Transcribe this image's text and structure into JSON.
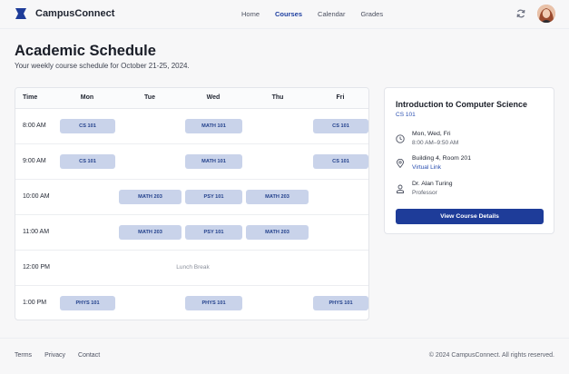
{
  "app": {
    "name": "CampusConnect",
    "nav": [
      {
        "label": "Home",
        "active": false
      },
      {
        "label": "Courses",
        "active": true
      },
      {
        "label": "Calendar",
        "active": false
      },
      {
        "label": "Grades",
        "active": false
      }
    ],
    "accent_color": "#1e3c99"
  },
  "page": {
    "title": "Academic Schedule",
    "subtitle": "Your weekly course schedule for October 21-25, 2024."
  },
  "schedule": {
    "headers": [
      "Time",
      "Mon",
      "Tue",
      "Wed",
      "Thu",
      "Fri"
    ],
    "rows": [
      {
        "time": "8:00 AM",
        "cells": [
          "CS 101",
          "",
          "MATH 101",
          "",
          "CS 101"
        ]
      },
      {
        "time": "9:00 AM",
        "cells": [
          "CS 101",
          "",
          "MATH 101",
          "",
          "CS 101"
        ]
      },
      {
        "time": "10:00 AM",
        "cells": [
          "",
          "MATH 203",
          "PSY 101",
          "MATH 203",
          ""
        ]
      },
      {
        "time": "11:00 AM",
        "cells": [
          "",
          "MATH 203",
          "PSY 101",
          "MATH 203",
          ""
        ]
      },
      {
        "time": "12:00 PM",
        "cells": [
          "",
          "",
          "",
          "",
          ""
        ],
        "note": "Lunch Break"
      },
      {
        "time": "1:00 PM",
        "cells": [
          "PHYS 101",
          "",
          "PHYS 101",
          "",
          "PHYS 101"
        ]
      }
    ]
  },
  "course_detail": {
    "title": "Introduction to Computer Science",
    "code": "CS 101",
    "days": "Mon, Wed, Fri",
    "time": "8:00 AM–9:50 AM",
    "location": "Building 4, Room 201",
    "virtual_link": "Virtual Link",
    "instructor": "Dr. Alan Turing",
    "instructor_role": "Professor",
    "button_label": "View Course Details",
    "icons": [
      "clock-icon",
      "map-pin-icon",
      "person-icon"
    ]
  },
  "footer": {
    "links": [
      "Terms",
      "Privacy",
      "Contact"
    ],
    "copyright": "© 2024 CampusConnect. All rights reserved."
  }
}
